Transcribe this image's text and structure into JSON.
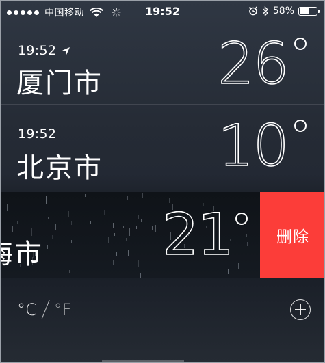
{
  "status_bar": {
    "carrier": "中国移动",
    "time": "19:52",
    "battery": "58%",
    "battery_level": 0.58,
    "icons": [
      "signal-dots",
      "wifi-icon",
      "spinner-icon",
      "alarm-icon",
      "bluetooth-icon",
      "battery-icon"
    ]
  },
  "cities": [
    {
      "time": "19:52",
      "name": "厦门市",
      "temp": "26",
      "current_location": true
    },
    {
      "time": "19:52",
      "name": "北京市",
      "temp": "10",
      "current_location": false
    }
  ],
  "swiped": {
    "name": "海市",
    "temp": "21",
    "delete_label": "删除"
  },
  "bottom": {
    "celsius": "°C",
    "fahrenheit": "°F",
    "add_icon": "plus-circle-icon"
  },
  "colors": {
    "delete_red": "#fc3d39"
  }
}
